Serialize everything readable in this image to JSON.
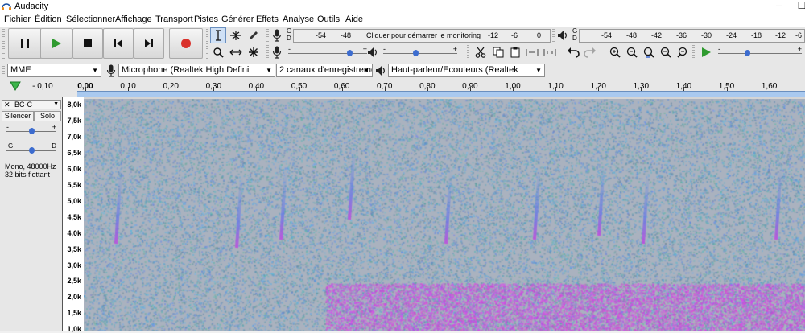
{
  "window": {
    "title": "Audacity",
    "minimize": "─",
    "maximize": "☐"
  },
  "menu": [
    "Fichier",
    "Édition",
    "Sélectionner",
    "Affichage",
    "Transport",
    "Pistes",
    "Générer",
    "Effets",
    "Analyse",
    "Outils",
    "Aide"
  ],
  "transport": {
    "pause_icon": "pause-icon",
    "play_icon": "play-icon",
    "stop_icon": "stop-icon",
    "skip_start_icon": "skip-start-icon",
    "skip_end_icon": "skip-end-icon",
    "record_icon": "record-icon"
  },
  "rec_meter": {
    "letters": [
      "G",
      "D"
    ],
    "ticks": [
      "-54",
      "-48",
      "-12",
      "-6",
      "0"
    ],
    "monitor_text": "Cliquer pour démarrer le monitoring"
  },
  "play_meter": {
    "letters": [
      "G",
      "D"
    ],
    "ticks": [
      "-54",
      "-48",
      "-42",
      "-36",
      "-30",
      "-24",
      "-18",
      "-12",
      "-6"
    ]
  },
  "sliders": {
    "minus": "-",
    "plus": "+"
  },
  "devices": {
    "host": "MME",
    "mic": "Microphone (Realtek High Defini",
    "channels": "2 canaux d'enregistremer",
    "speaker": "Haut-parleur/Ecouteurs (Realtek"
  },
  "ruler": {
    "labels": [
      "- 0,10",
      "0,00",
      "0,10",
      "0,20",
      "0,30",
      "0,40",
      "0,50",
      "0,60",
      "0,70",
      "0,80",
      "0,90",
      "1,00",
      "1,10",
      "1,20",
      "1,30",
      "1,40",
      "1,50",
      "1,60"
    ]
  },
  "track": {
    "name": "BC-C",
    "close": "✕",
    "menu_arrow": "▼",
    "mute": "Silencer",
    "solo": "Solo",
    "gain_minus": "-",
    "gain_plus": "+",
    "pan_left": "G",
    "pan_right": "D",
    "info_line1": "Mono, 48000Hz",
    "info_line2": "32 bits flottant"
  },
  "freq_axis": [
    "8,0k",
    "7,5k",
    "7,0k",
    "6,5k",
    "6,0k",
    "5,5k",
    "5,0k",
    "4,5k",
    "4,0k",
    "3,5k",
    "3,0k",
    "2,5k",
    "2,0k",
    "1,5k",
    "1,0k"
  ]
}
